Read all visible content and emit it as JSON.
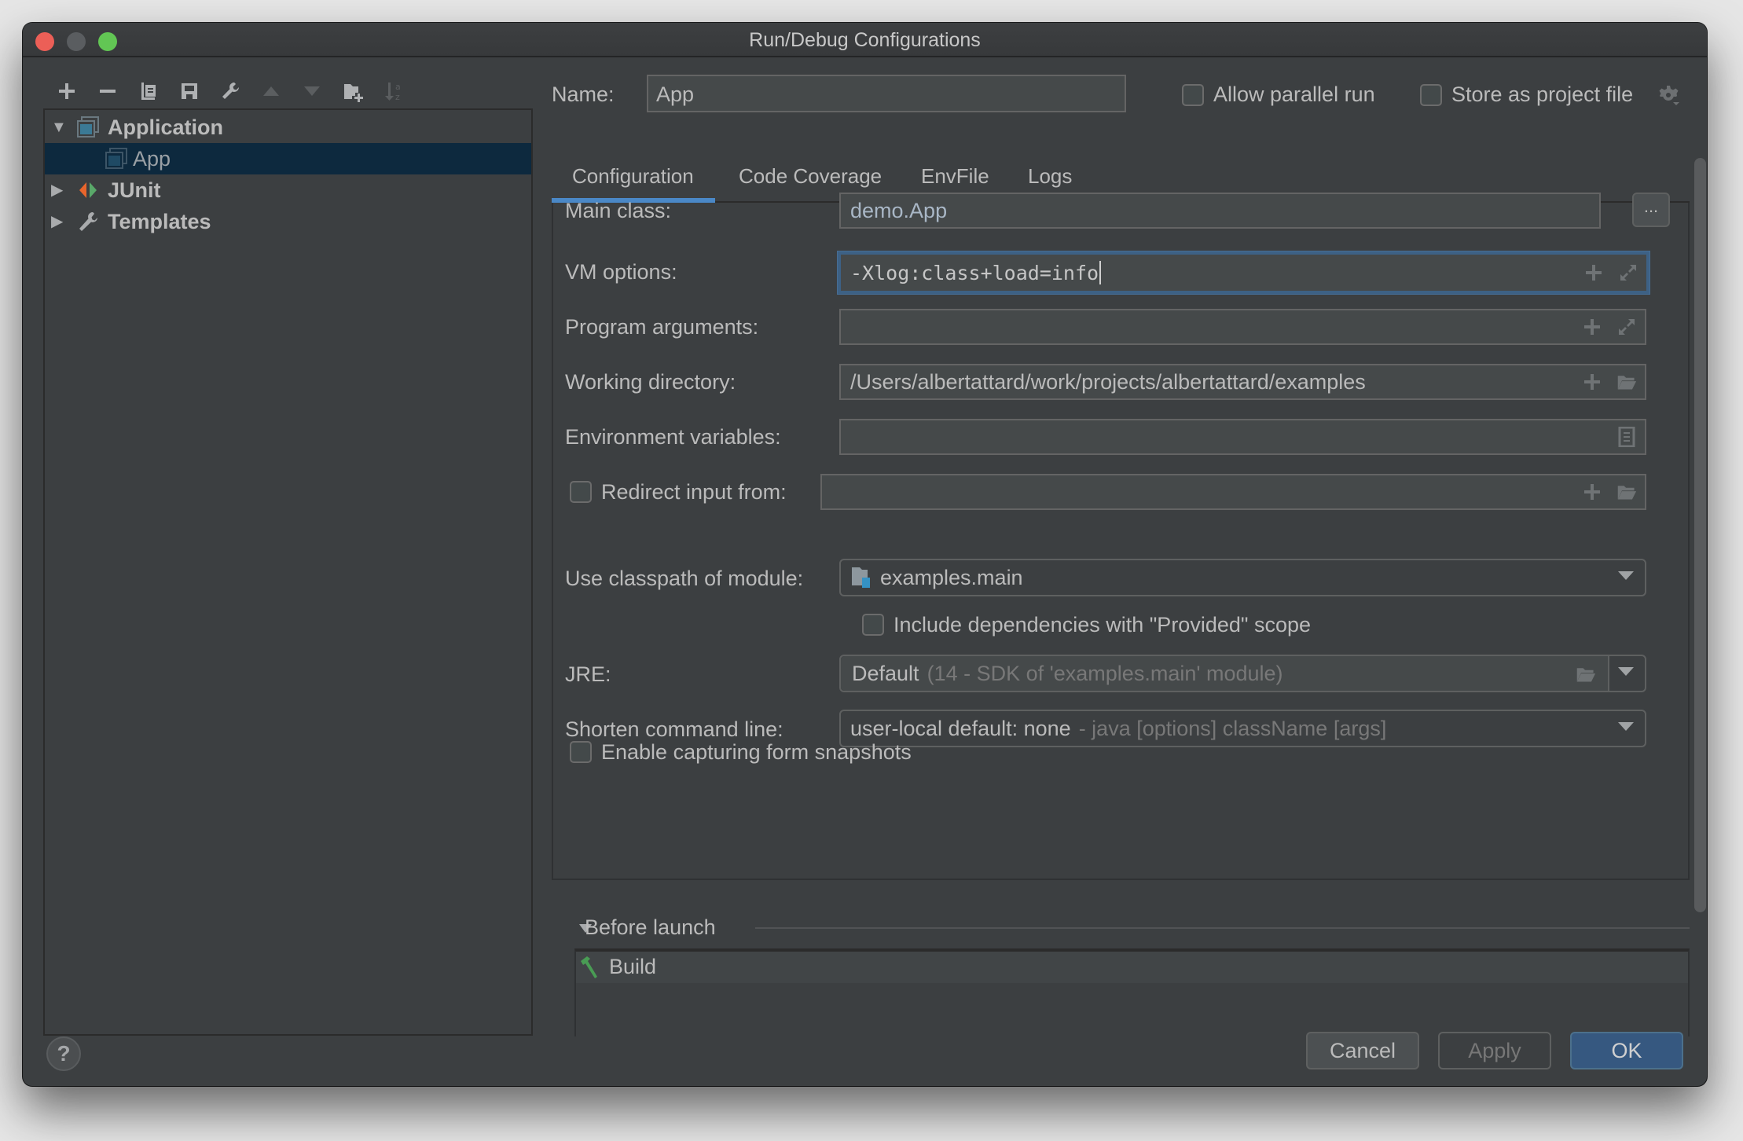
{
  "window": {
    "title": "Run/Debug Configurations"
  },
  "toolbar": {
    "buttons": [
      {
        "name": "add",
        "icon": "plus-icon",
        "enabled": true
      },
      {
        "name": "remove",
        "icon": "minus-icon",
        "enabled": true
      },
      {
        "name": "copy",
        "icon": "copy-icon",
        "enabled": true
      },
      {
        "name": "save",
        "icon": "save-icon",
        "enabled": true
      },
      {
        "name": "edit-defaults",
        "icon": "wrench-icon",
        "enabled": true
      },
      {
        "name": "move-up",
        "icon": "triangle-up-icon",
        "enabled": false
      },
      {
        "name": "move-down",
        "icon": "triangle-down-icon",
        "enabled": false
      },
      {
        "name": "new-folder",
        "icon": "folder-add-icon",
        "enabled": true
      },
      {
        "name": "sort",
        "icon": "sort-alpha-icon",
        "enabled": false
      }
    ]
  },
  "tree": {
    "items": [
      {
        "label": "Application",
        "expanded": true,
        "level": 0,
        "icon": "application-icon"
      },
      {
        "label": "App",
        "level": 1,
        "selected": true,
        "icon": "application-icon"
      },
      {
        "label": "JUnit",
        "expanded": false,
        "level": 0,
        "icon": "junit-icon"
      },
      {
        "label": "Templates",
        "expanded": false,
        "level": 0,
        "icon": "wrench-icon"
      }
    ]
  },
  "header": {
    "name_label": "Name:",
    "name_value": "App",
    "allow_parallel_label": "Allow parallel run",
    "allow_parallel_checked": false,
    "store_project_label": "Store as project file",
    "store_project_checked": false
  },
  "tabs": [
    {
      "label": "Configuration",
      "active": true
    },
    {
      "label": "Code Coverage",
      "active": false
    },
    {
      "label": "EnvFile",
      "active": false
    },
    {
      "label": "Logs",
      "active": false
    }
  ],
  "form": {
    "main_class": {
      "label": "Main class:",
      "value": "demo.App",
      "button": "..."
    },
    "vm_options": {
      "label": "VM options:",
      "value": "-Xlog:class+load=info"
    },
    "program_arguments": {
      "label": "Program arguments:",
      "value": ""
    },
    "working_directory": {
      "label": "Working directory:",
      "value": "/Users/albertattard/work/projects/albertattard/examples"
    },
    "environment_variables": {
      "label": "Environment variables:",
      "value": ""
    },
    "redirect_input": {
      "label": "Redirect input from:",
      "checked": false,
      "value": ""
    },
    "classpath_module": {
      "label": "Use classpath of module:",
      "value": "examples.main"
    },
    "include_provided": {
      "label": "Include dependencies with \"Provided\" scope",
      "checked": false
    },
    "jre": {
      "label": "JRE:",
      "value": "Default",
      "hint": "(14 - SDK of 'examples.main' module)"
    },
    "shorten_command_line": {
      "label": "Shorten command line:",
      "value": "user-local default: none",
      "hint": "- java [options] className [args]"
    },
    "capture_snapshots": {
      "label": "Enable capturing form snapshots",
      "checked": false
    }
  },
  "before_launch": {
    "label": "Before launch",
    "items": [
      {
        "label": "Build",
        "icon": "build-hammer-icon"
      }
    ]
  },
  "footer": {
    "help": "?",
    "cancel": "Cancel",
    "apply": "Apply",
    "ok": "OK"
  },
  "colors": {
    "accent": "#4a88c7",
    "ok_button": "#365880",
    "selection": "#0d293e",
    "focus_border": "#3d6185"
  }
}
